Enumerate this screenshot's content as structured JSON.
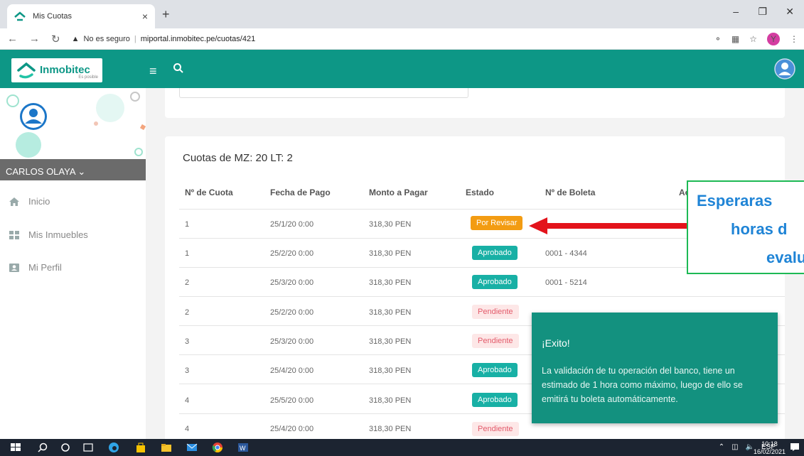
{
  "browser": {
    "tab_title": "Mis Cuotas",
    "tab_close": "×",
    "new_tab": "+",
    "security_label": "No es seguro",
    "url": "miportal.inmobitec.pe/cuotas/421",
    "profile_initial": "Y"
  },
  "header": {
    "logo_text": "Inmobitec",
    "logo_tagline": "Es posible"
  },
  "sidebar": {
    "user_name": "CARLOS OLAYA",
    "items": [
      {
        "label": "Inicio",
        "icon": "home-icon"
      },
      {
        "label": "Mis Inmuebles",
        "icon": "grid-icon"
      },
      {
        "label": "Mi Perfil",
        "icon": "profile-card-icon"
      }
    ]
  },
  "main": {
    "title": "Cuotas de MZ: 20 LT: 2",
    "columns": [
      "Nº de Cuota",
      "Fecha de Pago",
      "Monto a Pagar",
      "Estado",
      "Nº de Boleta",
      "Ac"
    ],
    "rows": [
      {
        "cuota": "1",
        "fecha": "25/1/20 0:00",
        "monto": "318,30 PEN",
        "estado": "Por Revisar",
        "boleta": ""
      },
      {
        "cuota": "1",
        "fecha": "25/2/20 0:00",
        "monto": "318,30 PEN",
        "estado": "Aprobado",
        "boleta": "0001 - 4344"
      },
      {
        "cuota": "2",
        "fecha": "25/3/20 0:00",
        "monto": "318,30 PEN",
        "estado": "Aprobado",
        "boleta": "0001 - 5214"
      },
      {
        "cuota": "2",
        "fecha": "25/2/20 0:00",
        "monto": "318,30 PEN",
        "estado": "Pendiente",
        "boleta": ""
      },
      {
        "cuota": "3",
        "fecha": "25/3/20 0:00",
        "monto": "318,30 PEN",
        "estado": "Pendiente",
        "boleta": ""
      },
      {
        "cuota": "3",
        "fecha": "25/4/20 0:00",
        "monto": "318,30 PEN",
        "estado": "Aprobado",
        "boleta": ""
      },
      {
        "cuota": "4",
        "fecha": "25/5/20 0:00",
        "monto": "318,30 PEN",
        "estado": "Aprobado",
        "boleta": ""
      },
      {
        "cuota": "4",
        "fecha": "25/4/20 0:00",
        "monto": "318,30 PEN",
        "estado": "Pendiente",
        "boleta": ""
      }
    ]
  },
  "callout": {
    "line1": "Esperaras",
    "line2": "horas d",
    "line3": "evalu"
  },
  "toast": {
    "title": "¡Exito!",
    "message": "La validación de tu operación del banco, tiene un estimado de 1 hora como máximo, luego de ello se emitirá tu boleta automáticamente."
  },
  "taskbar": {
    "lang": "ESP",
    "time": "10:18",
    "date": "16/02/2021"
  },
  "colors": {
    "brand": "#0d9786",
    "por_revisar": "#f39c12",
    "aprobado": "#18b0a5",
    "pendiente_bg": "#fde7e7",
    "pendiente_text": "#e35b6b",
    "callout_text": "#1f84d6",
    "callout_border": "#1db954",
    "arrow": "#e3131b"
  }
}
